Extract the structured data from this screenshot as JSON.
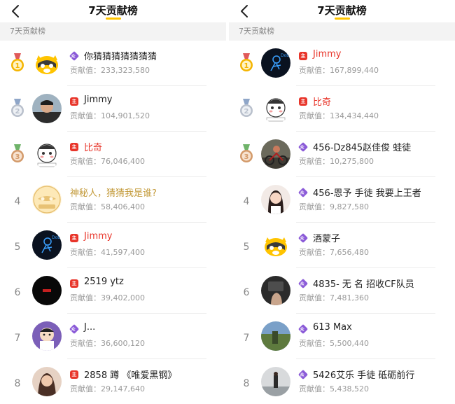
{
  "left": {
    "title": "7天贡献榜",
    "section": "7天贡献榜",
    "contrib_prefix": "贡献值：",
    "rows": [
      {
        "rank": "1",
        "medal": "gold",
        "badge": "fan",
        "name": "你猜猜猜猜猜猜猜",
        "value": "233,323,580",
        "avatar": "raccoon"
      },
      {
        "rank": "2",
        "medal": "silver",
        "badge": "host",
        "name": "Jimmy",
        "value": "104,901,520",
        "avatar": "photo-man"
      },
      {
        "rank": "3",
        "medal": "bronze",
        "badge": "host",
        "name": "比奇",
        "value": "76,046,400",
        "avatar": "cartoon-white",
        "name_style": "red"
      },
      {
        "rank": "4",
        "medal": "none",
        "badge": "none",
        "name": "神秘人，猜猜我是谁?",
        "value": "58,406,400",
        "avatar": "mystery",
        "name_style": "gold"
      },
      {
        "rank": "5",
        "medal": "none",
        "badge": "host",
        "name": "Jimmy",
        "value": "41,597,400",
        "avatar": "neon",
        "name_style": "red"
      },
      {
        "rank": "6",
        "medal": "none",
        "badge": "host",
        "name": "2519 ytz",
        "value": "39,402,000",
        "avatar": "black"
      },
      {
        "rank": "7",
        "medal": "none",
        "badge": "fan",
        "name": "J...",
        "value": "36,600,120",
        "avatar": "cartoon-purple"
      },
      {
        "rank": "8",
        "medal": "none",
        "badge": "host",
        "name": "2858  蹲 《唯爱黑钢》",
        "value": "29,147,640",
        "avatar": "photo-girl"
      }
    ]
  },
  "right": {
    "title": "7天贡献榜",
    "section": "7天贡献榜",
    "contrib_prefix": "贡献值：",
    "rows": [
      {
        "rank": "1",
        "medal": "gold",
        "badge": "host",
        "name": "Jimmy",
        "value": "167,899,440",
        "avatar": "neon",
        "name_style": "red"
      },
      {
        "rank": "2",
        "medal": "silver",
        "badge": "host",
        "name": "比奇",
        "value": "134,434,440",
        "avatar": "cartoon-white",
        "name_style": "red"
      },
      {
        "rank": "3",
        "medal": "bronze",
        "badge": "fan",
        "name": "456-Dz845赵佳俊 蛙徒",
        "value": "10,275,800",
        "avatar": "photo-bike"
      },
      {
        "rank": "4",
        "medal": "none",
        "badge": "fan",
        "name": "456-恩予 手徒   我要上王者",
        "value": "9,827,580",
        "avatar": "photo-girl2"
      },
      {
        "rank": "5",
        "medal": "none",
        "badge": "fan",
        "name": "酒蒙子",
        "value": "7,656,480",
        "avatar": "raccoon"
      },
      {
        "rank": "6",
        "medal": "none",
        "badge": "fan",
        "name": "4835- 无 名 招收CF队员",
        "value": "7,481,360",
        "avatar": "photo-hand"
      },
      {
        "rank": "7",
        "medal": "none",
        "badge": "fan",
        "name": "613 Max",
        "value": "5,500,440",
        "avatar": "photo-field"
      },
      {
        "rank": "8",
        "medal": "none",
        "badge": "fan",
        "name": "5426艾乐   手徒   砥砺前行",
        "value": "5,438,520",
        "avatar": "photo-street"
      }
    ]
  },
  "badge_text": {
    "host": "主",
    "fan": "众"
  },
  "colors": {
    "accent": "#ffc400",
    "red": "#e8352a",
    "gold_medal": "#f4b400",
    "silver_medal": "#b9c0cc",
    "bronze_medal": "#d39a6a"
  }
}
